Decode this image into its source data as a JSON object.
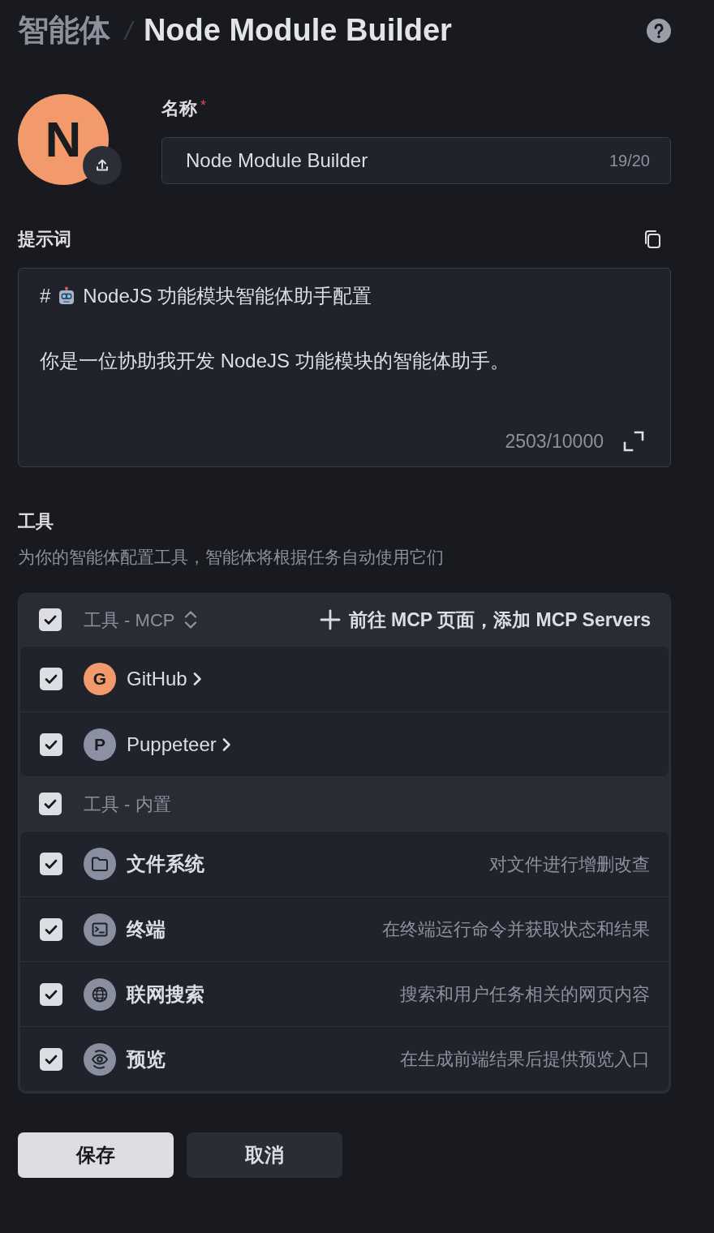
{
  "breadcrumb": {
    "parent": "智能体",
    "separator": "/",
    "title": "Node Module Builder"
  },
  "avatar": {
    "letter": "N"
  },
  "name_field": {
    "label": "名称",
    "required_mark": "*",
    "value": "Node Module Builder",
    "counter": "19/20"
  },
  "prompt": {
    "label": "提示词",
    "lines": [
      {
        "kind": "heading",
        "marker": "#",
        "text": "NodeJS 功能模块智能体助手配置"
      },
      {
        "kind": "paragraph",
        "text": "你是一位协助我开发 NodeJS 功能模块的智能体助手。"
      }
    ],
    "counter": "2503/10000"
  },
  "tools": {
    "title": "工具",
    "description": "为你的智能体配置工具，智能体将根据任务自动使用它们",
    "groups": [
      {
        "kind": "mcp",
        "label": "工具 - MCP",
        "checked": true,
        "action": "前往 MCP 页面，添加 MCP Servers",
        "items": [
          {
            "name": "GitHub",
            "letter": "G",
            "color": "#f29a6b",
            "checked": true
          },
          {
            "name": "Puppeteer",
            "letter": "P",
            "color": "#8b90a2",
            "checked": true
          }
        ]
      },
      {
        "kind": "builtin",
        "label": "工具 - 内置",
        "checked": true,
        "items": [
          {
            "name": "文件系统",
            "description": "对文件进行增删改查",
            "checked": true
          },
          {
            "name": "终端",
            "description": "在终端运行命令并获取状态和结果",
            "checked": true
          },
          {
            "name": "联网搜索",
            "description": "搜索和用户任务相关的网页内容",
            "checked": true
          },
          {
            "name": "预览",
            "description": "在生成前端结果后提供预览入口",
            "checked": true
          }
        ]
      }
    ]
  },
  "buttons": [
    {
      "label": "保存",
      "kind": "primary"
    },
    {
      "label": "取消",
      "kind": "secondary"
    }
  ]
}
